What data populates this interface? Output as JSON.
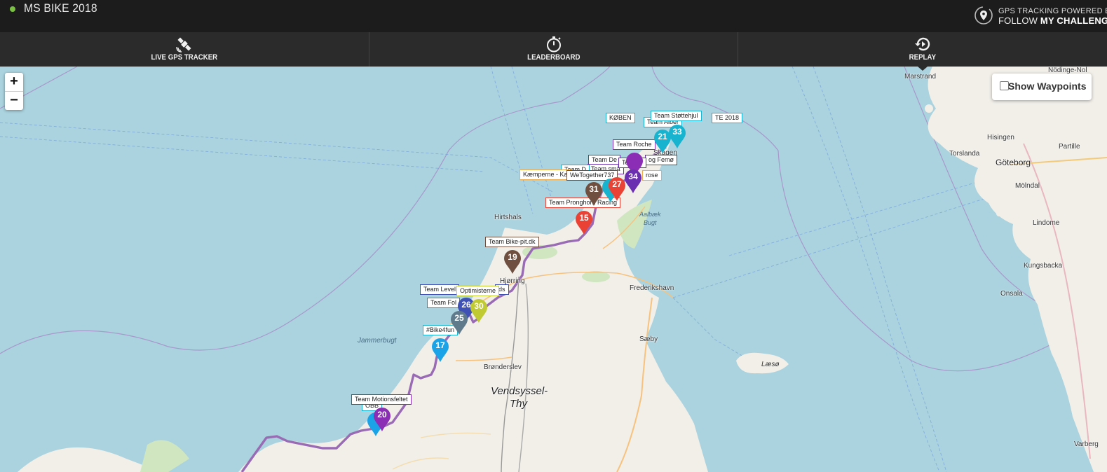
{
  "header": {
    "title": "MS BIKE 2018",
    "brand_line1": "GPS TRACKING POWERED BY",
    "brand_line2a": "FOLLOW ",
    "brand_line2b": "MY CHALLENGE"
  },
  "nav": {
    "live": "LIVE GPS TRACKER",
    "leaderboard": "LEADERBOARD",
    "replay": "REPLAY"
  },
  "map": {
    "zoom_in": "+",
    "zoom_out": "−",
    "show_waypoints": "Show Waypoints",
    "places": {
      "marstrand": "Marstrand",
      "nodinge": "Nödinge-Nol",
      "hisingen": "Hisingen",
      "torslanda": "Torslanda",
      "goteborg": "Göteborg",
      "partille": "Partille",
      "molndal": "Mölndal",
      "lindome": "Lindome",
      "kungsbacka": "Kungsbacka",
      "onsala": "Onsala",
      "varberg": "Varberg",
      "hirtshals": "Hirtshals",
      "skagen": "Skagen",
      "aalbaek_bugt_1": "Aalbæk",
      "aalbaek_bugt_2": "Bugt",
      "hjorring": "Hjørring",
      "frederikshavn": "Frederikshavn",
      "saeby": "Sæby",
      "laeso": "Læsø",
      "jammerbugt": "Jammerbugt",
      "bronderslev": "Brønderslev",
      "vendsyssel_1": "Vendsyssel-",
      "vendsyssel_2": "Thy"
    },
    "labels": {
      "kobenhavn": "KØBEN",
      "te2018": "TE 2018",
      "stottehjul": "Team Støttehjul",
      "team_alber": "Team Alber",
      "roche": "Team Roche",
      "team_de": "Team De",
      "team_smaa": "Team små",
      "team_t": "Team T",
      "og_femo": "og Femø",
      "team_d": "Team D",
      "kaemperne": "Kæmperne - Ka",
      "wetogether": "WeTogether737",
      "rose": "rose",
      "pronghorn": "Team Pronghorn Racing",
      "bikepit": "Team Bike-pit.dk",
      "team_level": "Team Level",
      "optimisterne": "Optimisterne",
      "ds": "ds",
      "team_fol": "Team Fol",
      "bike4fun": "#Bike4fun",
      "motionsfeltet": "Team Motionsfeltet",
      "obb": "OBB"
    },
    "markers": {
      "m21": "21",
      "m33": "33",
      "m34": "34",
      "m27": "27",
      "m31": "31",
      "m15": "15",
      "m19": "19",
      "m26": "26",
      "m30": "30",
      "m25": "25",
      "m17": "17",
      "m20": "20"
    },
    "colors": {
      "cyan": "#17b3cf",
      "purple": "#8b2db5",
      "deep_purple": "#6a2fb0",
      "red": "#ea4335",
      "brown": "#6f5040",
      "indigo": "#3f51b5",
      "lime": "#c0ca33",
      "slate": "#5f7a8a",
      "light_blue": "#1ba3e8",
      "route": "#9a6bb5"
    }
  }
}
